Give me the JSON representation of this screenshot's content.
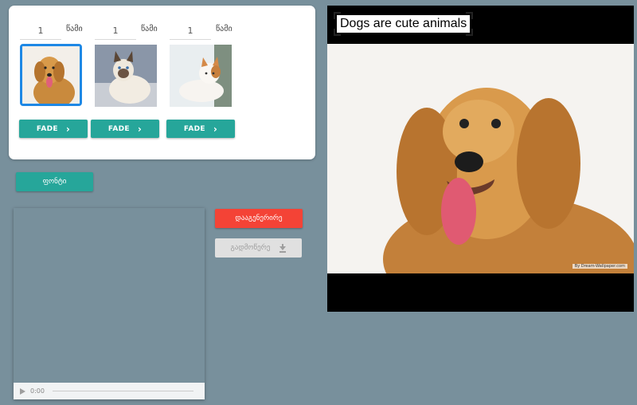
{
  "slides": [
    {
      "duration": "1",
      "unit": "წამი",
      "fade_label": "FADE",
      "image": "golden-retriever",
      "selected": true
    },
    {
      "duration": "1",
      "unit": "წამი",
      "fade_label": "FADE",
      "image": "siamese-cat",
      "selected": false
    },
    {
      "duration": "1",
      "unit": "წამი",
      "fade_label": "FADE",
      "image": "white-calico-cat",
      "selected": false
    }
  ],
  "font_button": "ფონტი",
  "generate_button": "დააგენერირე",
  "download_button": "გადმოწერე",
  "audio": {
    "time": "0:00"
  },
  "preview": {
    "caption": "Dogs are cute animals",
    "watermark": "By Dream-Wallpaper.com"
  },
  "colors": {
    "background": "#78909c",
    "fade": "#26a69a",
    "generate": "#f44336",
    "selected_border": "#1e88e5"
  }
}
